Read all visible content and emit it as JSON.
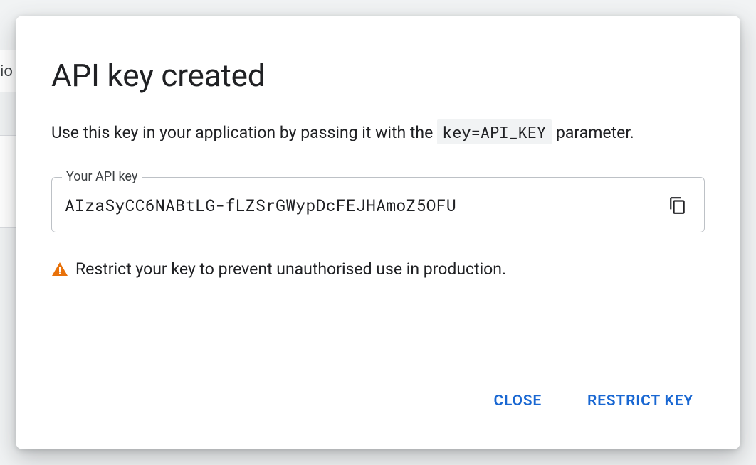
{
  "background": {
    "partial_label": "io"
  },
  "dialog": {
    "title": "API key created",
    "description_pre": "Use this key in your application by passing it with the ",
    "description_code": "key=API_KEY",
    "description_post": " parameter.",
    "field_label": "Your API key",
    "api_key": "AIzaSyCC6NABtLG-fLZSrGWypDcFEJHAmoZ5OFU",
    "warning_text": "Restrict your key to prevent unauthorised use in production.",
    "close_label": "CLOSE",
    "restrict_label": "RESTRICT KEY"
  }
}
